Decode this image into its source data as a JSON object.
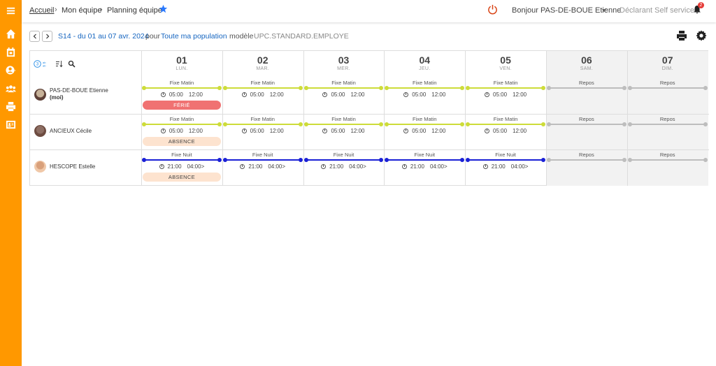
{
  "colors": {
    "sidebar": "#ff9800",
    "link": "#1565c0",
    "matin": "#cddc39",
    "nuit": "#1a20d6",
    "repos": "#bdbdbd",
    "ferie": "#f07272",
    "absence": "#fde3cf"
  },
  "sidebar": {
    "icons": [
      "menu-icon",
      "home-icon",
      "calendar-icon",
      "user-circle-icon",
      "team-icon",
      "print-icon",
      "id-card-icon"
    ]
  },
  "breadcrumb": {
    "home": "Accueil",
    "team": "Mon équipe",
    "page": "Planning équipe"
  },
  "header": {
    "greeting": "Bonjour PAS-DE-BOUE Etienne",
    "declarant": "Déclarant Self service",
    "notifications": "2"
  },
  "toolbar": {
    "week": "S14 - du 01 au 07 avr. 2024",
    "pour": "pour",
    "population": "Toute ma population",
    "modele_label": "modèle",
    "modele_value": "UPC.STANDARD.EMPLOYE"
  },
  "days": [
    {
      "num": "01",
      "name": "LUN."
    },
    {
      "num": "02",
      "name": "MAR."
    },
    {
      "num": "03",
      "name": "MER."
    },
    {
      "num": "04",
      "name": "JEU."
    },
    {
      "num": "05",
      "name": "VEN."
    },
    {
      "num": "06",
      "name": "SAM."
    },
    {
      "num": "07",
      "name": "DIM."
    }
  ],
  "employees": [
    {
      "name": "PAS-DE-BOUE Etienne",
      "sub": "(moi)",
      "cells": [
        {
          "shift": "Fixe Matin",
          "start": "05:00",
          "end": "12:00",
          "badge": "FÉRIÉ"
        },
        {
          "shift": "Fixe Matin",
          "start": "05:00",
          "end": "12:00"
        },
        {
          "shift": "Fixe Matin",
          "start": "05:00",
          "end": "12:00"
        },
        {
          "shift": "Fixe Matin",
          "start": "05:00",
          "end": "12:00"
        },
        {
          "shift": "Fixe Matin",
          "start": "05:00",
          "end": "12:00"
        },
        {
          "shift": "Repos"
        },
        {
          "shift": "Repos"
        }
      ]
    },
    {
      "name": "ANCIEUX Cécile",
      "sub": "",
      "cells": [
        {
          "shift": "Fixe Matin",
          "start": "05:00",
          "end": "12:00",
          "badge": "ABSENCE"
        },
        {
          "shift": "Fixe Matin",
          "start": "05:00",
          "end": "12:00"
        },
        {
          "shift": "Fixe Matin",
          "start": "05:00",
          "end": "12:00"
        },
        {
          "shift": "Fixe Matin",
          "start": "05:00",
          "end": "12:00"
        },
        {
          "shift": "Fixe Matin",
          "start": "05:00",
          "end": "12:00"
        },
        {
          "shift": "Repos"
        },
        {
          "shift": "Repos"
        }
      ]
    },
    {
      "name": "HESCOPE Estelle",
      "sub": "",
      "cells": [
        {
          "shift": "Fixe Nuit",
          "start": "21:00",
          "end": "04:00>",
          "badge": "ABSENCE"
        },
        {
          "shift": "Fixe Nuit",
          "start": "21:00",
          "end": "04:00>"
        },
        {
          "shift": "Fixe Nuit",
          "start": "21:00",
          "end": "04:00>"
        },
        {
          "shift": "Fixe Nuit",
          "start": "21:00",
          "end": "04:00>"
        },
        {
          "shift": "Fixe Nuit",
          "start": "21:00",
          "end": "04:00>"
        },
        {
          "shift": "Repos"
        },
        {
          "shift": "Repos"
        }
      ]
    }
  ]
}
